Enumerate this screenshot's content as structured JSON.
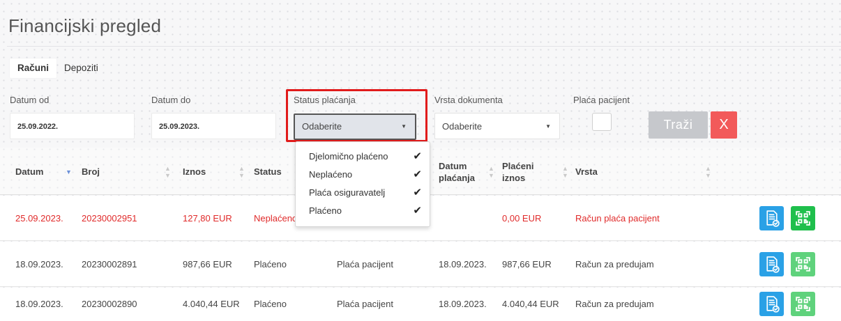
{
  "header": {
    "title": "Financijski pregled"
  },
  "tabs": [
    {
      "label": "Računi",
      "active": true
    },
    {
      "label": "Depoziti",
      "active": false
    }
  ],
  "filters": {
    "date_from": {
      "label": "Datum od",
      "value": "25.09.2022."
    },
    "date_to": {
      "label": "Datum do",
      "value": "25.09.2023."
    },
    "payment_status": {
      "label": "Status plaćanja",
      "value": "Odaberite"
    },
    "document_type": {
      "label": "Vrsta dokumenta",
      "value": "Odaberite"
    },
    "patient_pays": {
      "label": "Plaća pacijent",
      "checked": false
    },
    "search_label": "Traži",
    "clear_label": "X"
  },
  "status_dropdown": {
    "options": [
      {
        "label": "Djelomično plaćeno",
        "checked": true
      },
      {
        "label": "Neplaćeno",
        "checked": true
      },
      {
        "label": "Plaća osiguravatelj",
        "checked": true
      },
      {
        "label": "Plaćeno",
        "checked": true
      }
    ],
    "check_glyph": "✔"
  },
  "table": {
    "headers": {
      "datum": "Datum",
      "broj": "Broj",
      "iznos": "Iznos",
      "status": "Status",
      "datum_placanja_1": "Datum",
      "datum_placanja_2": "plaćanja",
      "placeni_iznos_1": "Plaćeni",
      "placeni_iznos_2": "iznos",
      "vrsta": "Vrsta"
    },
    "rows": [
      {
        "datum": "25.09.2023.",
        "broj": "20230002951",
        "iznos": "127,80 EUR",
        "status": "Neplaćeno",
        "nacin": "",
        "datum_placanja": "",
        "placeni_iznos": "0,00 EUR",
        "vrsta": "Račun plaća pacijent",
        "unpaid": true
      },
      {
        "datum": "18.09.2023.",
        "broj": "20230002891",
        "iznos": "987,66 EUR",
        "status": "Plaćeno",
        "nacin": "Plaća pacijent",
        "datum_placanja": "18.09.2023.",
        "placeni_iznos": "987,66 EUR",
        "vrsta": "Račun za predujam",
        "unpaid": false
      },
      {
        "datum": "18.09.2023.",
        "broj": "20230002890",
        "iznos": "4.040,44 EUR",
        "status": "Plaćeno",
        "nacin": "Plaća pacijent",
        "datum_placanja": "18.09.2023.",
        "placeni_iznos": "4.040,44 EUR",
        "vrsta": "Račun za predujam",
        "unpaid": false
      }
    ]
  },
  "colors": {
    "unpaid_text": "#e02a2a",
    "doc_button": "#2aa1e6",
    "qr_button": "#1fbf4c",
    "highlight_outline": "#e11b1b"
  }
}
